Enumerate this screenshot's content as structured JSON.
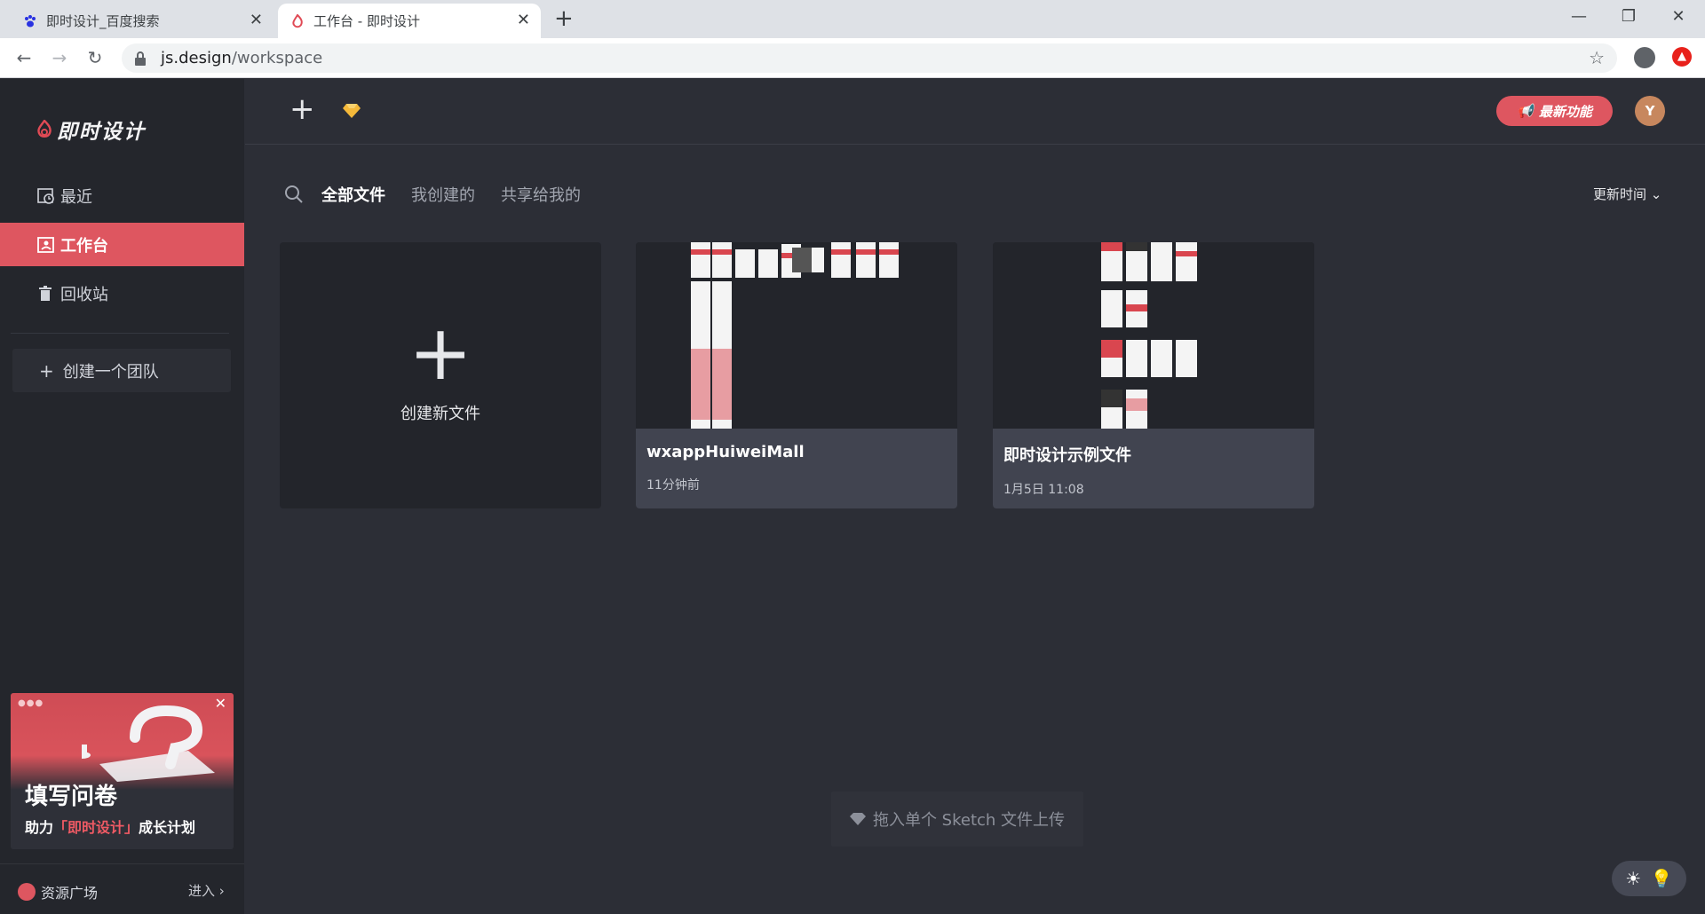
{
  "browser": {
    "tabs": [
      {
        "title": "即时设计_百度搜索",
        "active": false
      },
      {
        "title": "工作台 - 即时设计",
        "active": true
      }
    ],
    "url_host": "js.design",
    "url_path": "/workspace"
  },
  "sidebar": {
    "logo": "即时设计",
    "items": [
      {
        "label": "最近",
        "icon": "recent-clock-icon"
      },
      {
        "label": "工作台",
        "icon": "workspace-icon",
        "active": true
      },
      {
        "label": "回收站",
        "icon": "trash-icon"
      }
    ],
    "create_team": "创建一个团队",
    "survey": {
      "title": "填写问卷",
      "sub_prefix": "助力",
      "sub_highlight": "「即时设计」",
      "sub_suffix": "成长计划"
    },
    "resource_label": "资源广场",
    "enter_label": "进入"
  },
  "header": {
    "new_feature": "最新功能",
    "avatar_letter": "Y"
  },
  "filters": {
    "tabs": [
      "全部文件",
      "我创建的",
      "共享给我的"
    ],
    "active_index": 0,
    "sort_label": "更新时间"
  },
  "files": {
    "new_label": "创建新文件",
    "items": [
      {
        "name": "wxappHuiweiMall",
        "time": "11分钟前"
      },
      {
        "name": "即时设计示例文件",
        "time": "1月5日 11:08"
      }
    ]
  },
  "upload_hint": "拖入单个 Sketch 文件上传",
  "colors": {
    "accent": "#de5660",
    "sidebar_bg": "#24262c",
    "main_bg": "#2c2e36",
    "card_info_bg": "#414450"
  }
}
